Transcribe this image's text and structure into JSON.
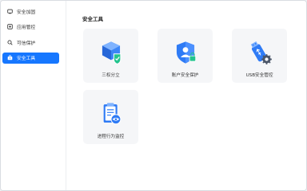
{
  "sidebar": {
    "items": [
      {
        "label": "安全加固",
        "icon": "shield-board-icon",
        "active": false
      },
      {
        "label": "应用管控",
        "icon": "app-control-icon",
        "active": false
      },
      {
        "label": "可信保护",
        "icon": "trust-search-icon",
        "active": false
      },
      {
        "label": "安全工具",
        "icon": "toolbox-icon",
        "active": true
      }
    ]
  },
  "main": {
    "title": "安全工具",
    "tools": [
      {
        "label": "三权分立",
        "icon": "three-cube-shield-icon"
      },
      {
        "label": "账户安全保护",
        "icon": "account-shield-icon"
      },
      {
        "label": "USB安全管控",
        "icon": "usb-gear-icon"
      },
      {
        "label": "进程行为监控",
        "icon": "process-clipboard-eye-icon"
      }
    ]
  },
  "colors": {
    "accent": "#1677ff",
    "card_bg": "#f5f6f8",
    "icon_blue": "#2f7bf5",
    "icon_green": "#23c48e"
  }
}
